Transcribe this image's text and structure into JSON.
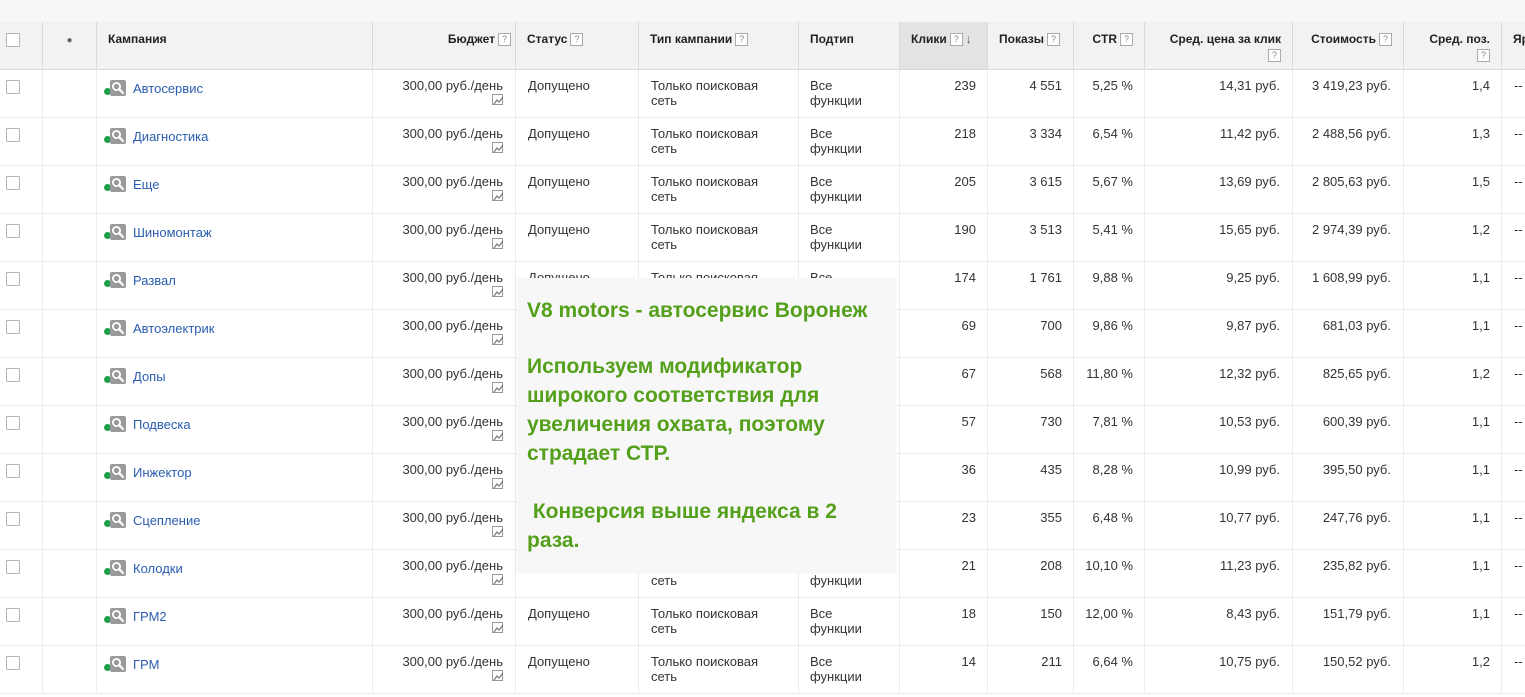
{
  "headers": {
    "campaign": "Кампания",
    "budget": "Бюджет",
    "status": "Статус",
    "campaign_type": "Тип кампании",
    "subtype": "Подтип",
    "clicks": "Клики",
    "impressions": "Показы",
    "ctr": "CTR",
    "avg_cpc": "Сред. цена за клик",
    "cost": "Стоимость",
    "avg_pos": "Сред. поз.",
    "cut": "Яр",
    "help": "?",
    "sort_arrow": "↓",
    "dot_header": "●"
  },
  "colors": {
    "enabled_dot": "#1e9e4a",
    "link": "#2a5db0",
    "overlay_text": "#54a01b"
  },
  "icons": {
    "search": "search-icon",
    "trend": "trend-chart-icon",
    "status_dot": "status-dot-icon"
  },
  "rows": [
    {
      "name": "Автосервис",
      "budget": "300,00 руб./день",
      "status": "Допущено",
      "type1": "Только поисковая",
      "type2": "сеть",
      "sub1": "Все",
      "sub2": "функции",
      "clicks": "239",
      "impressions": "4 551",
      "ctr": "5,25 %",
      "cpc": "14,31 руб.",
      "cost": "3 419,23 руб.",
      "pos": "1,4",
      "cut": "--"
    },
    {
      "name": "Диагностика",
      "budget": "300,00 руб./день",
      "status": "Допущено",
      "type1": "Только поисковая",
      "type2": "сеть",
      "sub1": "Все",
      "sub2": "функции",
      "clicks": "218",
      "impressions": "3 334",
      "ctr": "6,54 %",
      "cpc": "11,42 руб.",
      "cost": "2 488,56 руб.",
      "pos": "1,3",
      "cut": "--"
    },
    {
      "name": "Еще",
      "budget": "300,00 руб./день",
      "status": "Допущено",
      "type1": "Только поисковая",
      "type2": "сеть",
      "sub1": "Все",
      "sub2": "функции",
      "clicks": "205",
      "impressions": "3 615",
      "ctr": "5,67 %",
      "cpc": "13,69 руб.",
      "cost": "2 805,63 руб.",
      "pos": "1,5",
      "cut": "--"
    },
    {
      "name": "Шиномонтаж",
      "budget": "300,00 руб./день",
      "status": "Допущено",
      "type1": "Только поисковая",
      "type2": "сеть",
      "sub1": "Все",
      "sub2": "функции",
      "clicks": "190",
      "impressions": "3 513",
      "ctr": "5,41 %",
      "cpc": "15,65 руб.",
      "cost": "2 974,39 руб.",
      "pos": "1,2",
      "cut": "--"
    },
    {
      "name": "Развал",
      "budget": "300,00 руб./день",
      "status": "Допущено",
      "type1": "Только поисковая",
      "type2": "сеть",
      "sub1": "Все",
      "sub2": "функции",
      "clicks": "174",
      "impressions": "1 761",
      "ctr": "9,88 %",
      "cpc": "9,25 руб.",
      "cost": "1 608,99 руб.",
      "pos": "1,1",
      "cut": "--"
    },
    {
      "name": "Автоэлектрик",
      "budget": "300,00 руб./день",
      "status": "",
      "type1": "",
      "type2": "",
      "sub1": "",
      "sub2": "",
      "clicks": "69",
      "impressions": "700",
      "ctr": "9,86 %",
      "cpc": "9,87 руб.",
      "cost": "681,03 руб.",
      "pos": "1,1",
      "cut": "--"
    },
    {
      "name": "Допы",
      "budget": "300,00 руб./день",
      "status": "",
      "type1": "",
      "type2": "",
      "sub1": "",
      "sub2": "",
      "clicks": "67",
      "impressions": "568",
      "ctr": "11,80 %",
      "cpc": "12,32 руб.",
      "cost": "825,65 руб.",
      "pos": "1,2",
      "cut": "--"
    },
    {
      "name": "Подвеска",
      "budget": "300,00 руб./день",
      "status": "",
      "type1": "",
      "type2": "",
      "sub1": "",
      "sub2": "",
      "clicks": "57",
      "impressions": "730",
      "ctr": "7,81 %",
      "cpc": "10,53 руб.",
      "cost": "600,39 руб.",
      "pos": "1,1",
      "cut": "--"
    },
    {
      "name": "Инжектор",
      "budget": "300,00 руб./день",
      "status": "",
      "type1": "",
      "type2": "",
      "sub1": "",
      "sub2": "",
      "clicks": "36",
      "impressions": "435",
      "ctr": "8,28 %",
      "cpc": "10,99 руб.",
      "cost": "395,50 руб.",
      "pos": "1,1",
      "cut": "--"
    },
    {
      "name": "Сцепление",
      "budget": "300,00 руб./день",
      "status": "",
      "type1": "",
      "type2": "",
      "sub1": "",
      "sub2": "",
      "clicks": "23",
      "impressions": "355",
      "ctr": "6,48 %",
      "cpc": "10,77 руб.",
      "cost": "247,76 руб.",
      "pos": "1,1",
      "cut": "--"
    },
    {
      "name": "Колодки",
      "budget": "300,00 руб./день",
      "status": "",
      "type1": "",
      "type2": "сеть",
      "sub1": "",
      "sub2": "функции",
      "clicks": "21",
      "impressions": "208",
      "ctr": "10,10 %",
      "cpc": "11,23 руб.",
      "cost": "235,82 руб.",
      "pos": "1,1",
      "cut": "--"
    },
    {
      "name": "ГРМ2",
      "budget": "300,00 руб./день",
      "status": "Допущено",
      "type1": "Только поисковая",
      "type2": "сеть",
      "sub1": "Все",
      "sub2": "функции",
      "clicks": "18",
      "impressions": "150",
      "ctr": "12,00 %",
      "cpc": "8,43 руб.",
      "cost": "151,79 руб.",
      "pos": "1,1",
      "cut": "--"
    },
    {
      "name": "ГРМ",
      "budget": "300,00 руб./день",
      "status": "Допущено",
      "type1": "Только поисковая",
      "type2": "сеть",
      "sub1": "Все",
      "sub2": "функции",
      "clicks": "14",
      "impressions": "211",
      "ctr": "6,64 %",
      "cpc": "10,75 руб.",
      "cost": "150,52 руб.",
      "pos": "1,2",
      "cut": "--"
    }
  ],
  "overlay": {
    "title": "V8 motors - автосервис Воронеж",
    "paragraph1": "Используем модификатор широкого соответствия для увеличения охвата, поэтому страдает СТР.",
    "paragraph2": " Конверсия выше яндекса в 2 раза."
  }
}
